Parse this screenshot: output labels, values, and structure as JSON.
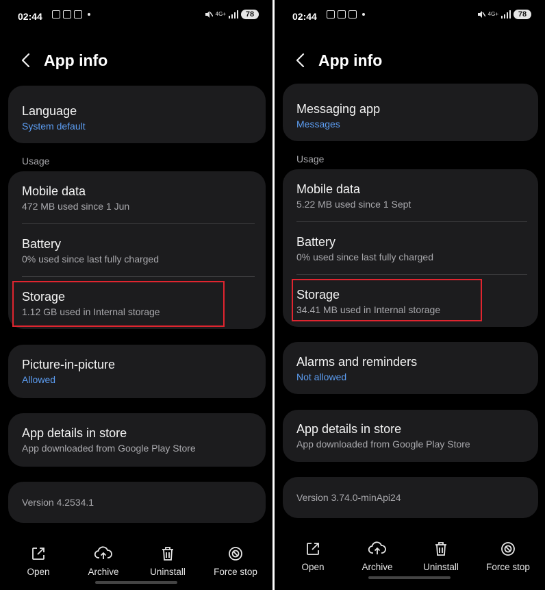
{
  "status": {
    "time": "02:44",
    "net": "4G+",
    "battery": "78"
  },
  "screens": [
    {
      "header": {
        "title": "App info"
      },
      "top_card": {
        "title": "Language",
        "sub": "System default"
      },
      "usage_label": "Usage",
      "usage": [
        {
          "title": "Mobile data",
          "sub": "472 MB used since 1 Jun"
        },
        {
          "title": "Battery",
          "sub": "0% used since last fully charged"
        },
        {
          "title": "Storage",
          "sub": "1.12 GB used in Internal storage"
        }
      ],
      "permission_card": {
        "title": "Picture-in-picture",
        "sub": "Allowed"
      },
      "store_card": {
        "title": "App details in store",
        "sub": "App downloaded from Google Play Store"
      },
      "version": "Version 4.2534.1"
    },
    {
      "header": {
        "title": "App info"
      },
      "top_card": {
        "title": "Messaging app",
        "sub": "Messages"
      },
      "usage_label": "Usage",
      "usage": [
        {
          "title": "Mobile data",
          "sub": "5.22 MB used since 1 Sept"
        },
        {
          "title": "Battery",
          "sub": "0% used since last fully charged"
        },
        {
          "title": "Storage",
          "sub": "34.41 MB used in Internal storage"
        }
      ],
      "permission_card": {
        "title": "Alarms and reminders",
        "sub": "Not allowed"
      },
      "store_card": {
        "title": "App details in store",
        "sub": "App downloaded from Google Play Store"
      },
      "version": "Version 3.74.0-minApi24"
    }
  ],
  "actions": {
    "open": "Open",
    "archive": "Archive",
    "uninstall": "Uninstall",
    "force_stop": "Force stop"
  },
  "colors": {
    "background": "#000000",
    "card": "#1c1c1e",
    "link": "#5c9df2",
    "highlight": "#e0252f"
  }
}
